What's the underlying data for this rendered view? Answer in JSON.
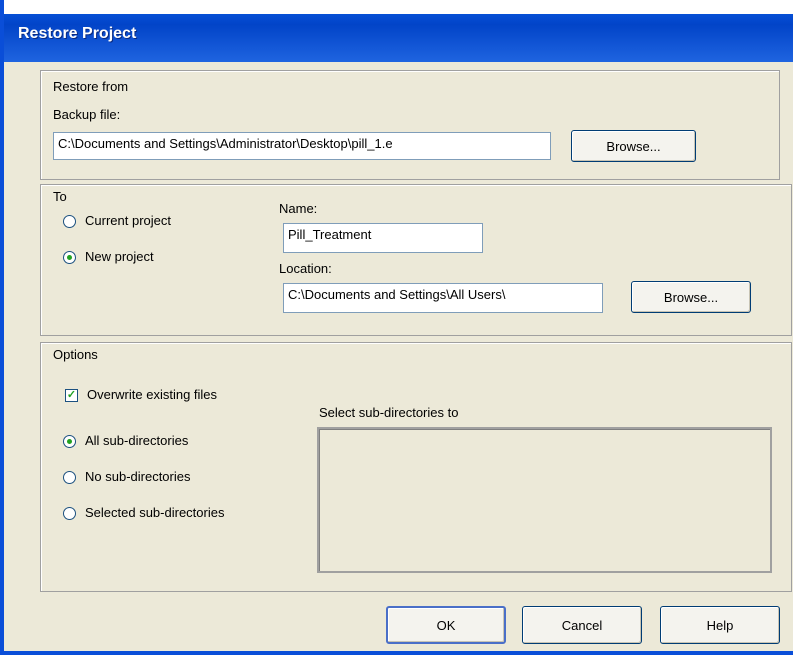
{
  "window": {
    "title": "Restore Project"
  },
  "restore_from": {
    "label": "Restore from",
    "backup_file_label": "Backup file:",
    "backup_file_value": "C:\\Documents and Settings\\Administrator\\Desktop\\pill_1.e",
    "browse_label": "Browse..."
  },
  "to": {
    "group_label": "To",
    "options": [
      {
        "label": "Current project",
        "selected": false
      },
      {
        "label": "New project",
        "selected": true
      }
    ],
    "name_label": "Name:",
    "name_value": "Pill_Treatment",
    "location_label": "Location:",
    "location_value": "C:\\Documents and Settings\\All Users\\",
    "browse_label": "Browse..."
  },
  "options": {
    "group_label": "Options",
    "overwrite_label": "Overwrite existing files",
    "overwrite_checked": true,
    "subdir_options": [
      {
        "label": "All sub-directories",
        "selected": true
      },
      {
        "label": "No sub-directories",
        "selected": false
      },
      {
        "label": "Selected sub-directories",
        "selected": false
      }
    ],
    "select_subdirs_label": "Select sub-directories to"
  },
  "buttons": {
    "ok": "OK",
    "cancel": "Cancel",
    "help": "Help"
  }
}
